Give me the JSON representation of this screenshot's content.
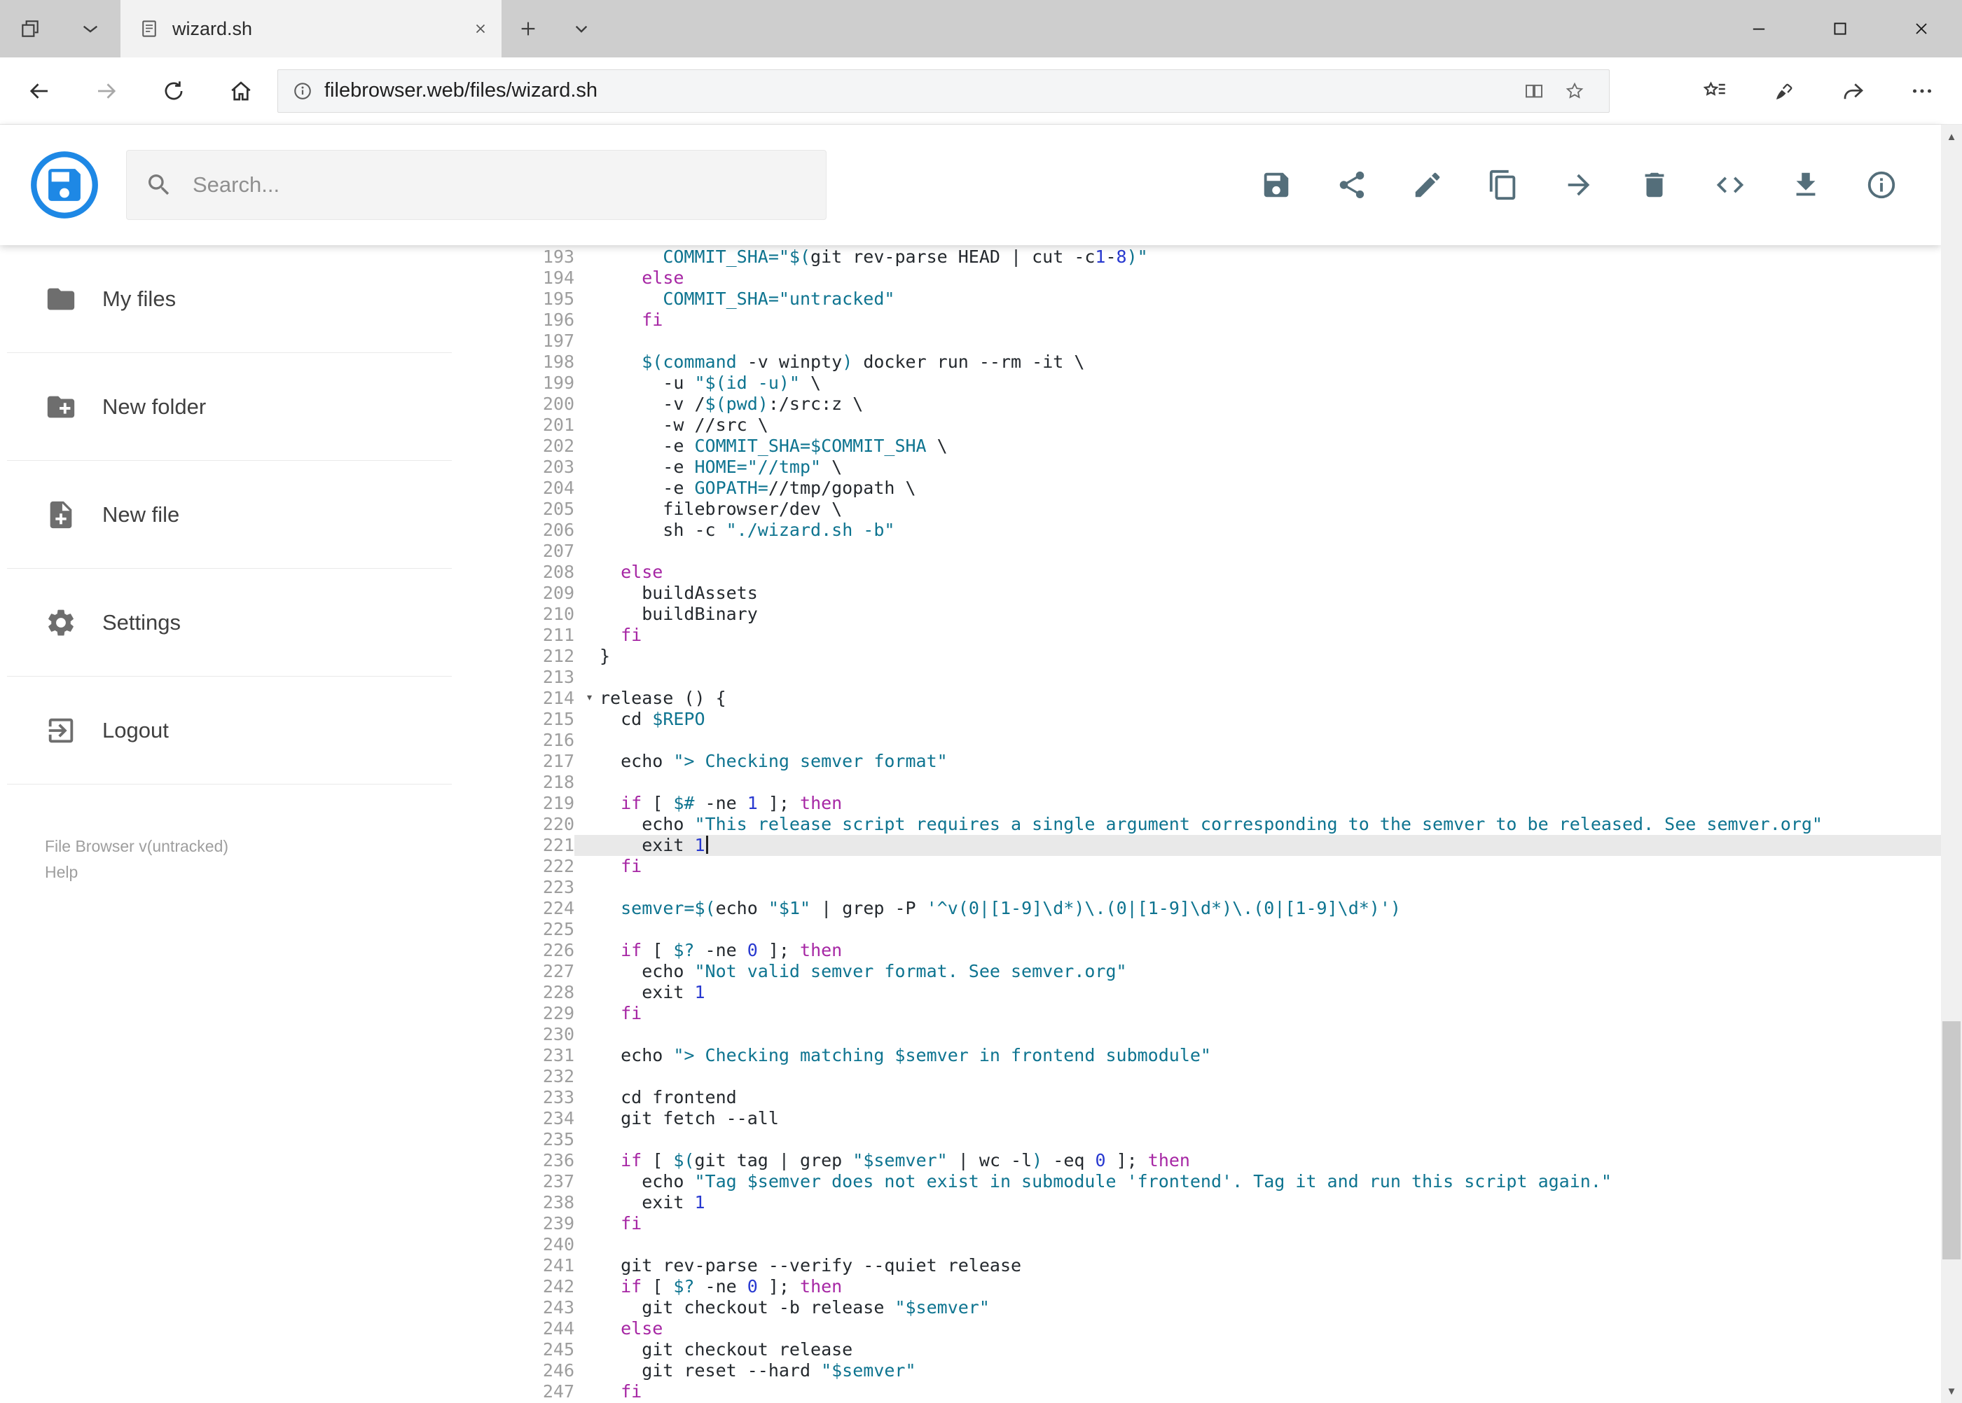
{
  "window": {
    "tab_title": "wizard.sh"
  },
  "browser": {
    "url_domain": "filebrowser.web",
    "url_path": "/files/wizard.sh"
  },
  "app": {
    "search_placeholder": "Search...",
    "actions": [
      {
        "name": "save",
        "icon": "save"
      },
      {
        "name": "share",
        "icon": "share"
      },
      {
        "name": "rename",
        "icon": "pencil"
      },
      {
        "name": "copy",
        "icon": "copy"
      },
      {
        "name": "move",
        "icon": "arrow-forward"
      },
      {
        "name": "delete",
        "icon": "trash"
      },
      {
        "name": "raw",
        "icon": "code"
      },
      {
        "name": "download",
        "icon": "download"
      },
      {
        "name": "info",
        "icon": "info"
      }
    ],
    "sidebar": {
      "items": [
        {
          "label": "My files",
          "icon": "folder"
        },
        {
          "label": "New folder",
          "icon": "folder-plus"
        },
        {
          "label": "New file",
          "icon": "file-plus"
        },
        {
          "label": "Settings",
          "icon": "gear"
        },
        {
          "label": "Logout",
          "icon": "logout"
        }
      ],
      "version": "File Browser v(untracked)",
      "help": "Help"
    }
  },
  "editor": {
    "active_line": 221,
    "lines": [
      {
        "n": 193,
        "segs": [
          [
            "p",
            "      "
          ],
          [
            "s",
            "COMMIT_SHA=\"$("
          ],
          [
            "p",
            "git rev-parse HEAD | cut -c"
          ],
          [
            "n",
            "1"
          ],
          [
            "p",
            "-"
          ],
          [
            "n",
            "8"
          ],
          [
            "s",
            ")\""
          ]
        ]
      },
      {
        "n": 194,
        "segs": [
          [
            "p",
            "    "
          ],
          [
            "k",
            "else"
          ]
        ]
      },
      {
        "n": 195,
        "segs": [
          [
            "p",
            "      "
          ],
          [
            "s",
            "COMMIT_SHA=\"untracked\""
          ]
        ]
      },
      {
        "n": 196,
        "segs": [
          [
            "p",
            "    "
          ],
          [
            "k",
            "fi"
          ]
        ]
      },
      {
        "n": 197,
        "segs": []
      },
      {
        "n": 198,
        "segs": [
          [
            "p",
            "    "
          ],
          [
            "s",
            "$(command"
          ],
          [
            "p",
            " -v winpty"
          ],
          [
            "s",
            ")"
          ],
          [
            "p",
            " docker run --rm -it \\"
          ]
        ]
      },
      {
        "n": 199,
        "segs": [
          [
            "p",
            "      -u "
          ],
          [
            "s",
            "\"$(id -u)\""
          ],
          [
            "p",
            " \\"
          ]
        ]
      },
      {
        "n": 200,
        "segs": [
          [
            "p",
            "      -v /"
          ],
          [
            "s",
            "$(pwd)"
          ],
          [
            "p",
            ":/src:z \\"
          ]
        ]
      },
      {
        "n": 201,
        "segs": [
          [
            "p",
            "      -w //src \\"
          ]
        ]
      },
      {
        "n": 202,
        "segs": [
          [
            "p",
            "      -e "
          ],
          [
            "s",
            "COMMIT_SHA=$COMMIT_SHA"
          ],
          [
            "p",
            " \\"
          ]
        ]
      },
      {
        "n": 203,
        "segs": [
          [
            "p",
            "      -e "
          ],
          [
            "s",
            "HOME=\"//tmp\""
          ],
          [
            "p",
            " \\"
          ]
        ]
      },
      {
        "n": 204,
        "segs": [
          [
            "p",
            "      -e "
          ],
          [
            "s",
            "GOPATH="
          ],
          [
            "p",
            "//tmp/gopath \\"
          ]
        ]
      },
      {
        "n": 205,
        "segs": [
          [
            "p",
            "      filebrowser/dev \\"
          ]
        ]
      },
      {
        "n": 206,
        "segs": [
          [
            "p",
            "      sh -c "
          ],
          [
            "s",
            "\"./wizard.sh -b\""
          ]
        ]
      },
      {
        "n": 207,
        "segs": []
      },
      {
        "n": 208,
        "segs": [
          [
            "p",
            "  "
          ],
          [
            "k",
            "else"
          ]
        ]
      },
      {
        "n": 209,
        "segs": [
          [
            "p",
            "    buildAssets"
          ]
        ]
      },
      {
        "n": 210,
        "segs": [
          [
            "p",
            "    buildBinary"
          ]
        ]
      },
      {
        "n": 211,
        "segs": [
          [
            "p",
            "  "
          ],
          [
            "k",
            "fi"
          ]
        ]
      },
      {
        "n": 212,
        "segs": [
          [
            "p",
            "}"
          ]
        ]
      },
      {
        "n": 213,
        "segs": []
      },
      {
        "n": 214,
        "fold": true,
        "segs": [
          [
            "p",
            "release () {"
          ]
        ]
      },
      {
        "n": 215,
        "segs": [
          [
            "p",
            "  cd "
          ],
          [
            "s",
            "$REPO"
          ]
        ]
      },
      {
        "n": 216,
        "segs": []
      },
      {
        "n": 217,
        "segs": [
          [
            "p",
            "  echo "
          ],
          [
            "s",
            "\"> Checking semver format\""
          ]
        ]
      },
      {
        "n": 218,
        "segs": []
      },
      {
        "n": 219,
        "segs": [
          [
            "p",
            "  "
          ],
          [
            "k",
            "if"
          ],
          [
            "p",
            " [ "
          ],
          [
            "s",
            "$#"
          ],
          [
            "p",
            " -ne "
          ],
          [
            "n",
            "1"
          ],
          [
            "p",
            " ]; "
          ],
          [
            "k",
            "then"
          ]
        ]
      },
      {
        "n": 220,
        "segs": [
          [
            "p",
            "    echo "
          ],
          [
            "s",
            "\"This release script requires a single argument corresponding to the semver to be released. See semver.org\""
          ]
        ]
      },
      {
        "n": 221,
        "cursor": true,
        "segs": [
          [
            "p",
            "    exit "
          ],
          [
            "n",
            "1"
          ]
        ]
      },
      {
        "n": 222,
        "segs": [
          [
            "p",
            "  "
          ],
          [
            "k",
            "fi"
          ]
        ]
      },
      {
        "n": 223,
        "segs": []
      },
      {
        "n": 224,
        "segs": [
          [
            "p",
            "  "
          ],
          [
            "s",
            "semver=$("
          ],
          [
            "p",
            "echo "
          ],
          [
            "s",
            "\"$1\""
          ],
          [
            "p",
            " | grep -P "
          ],
          [
            "s",
            "'^v(0|[1-9]\\d*)\\.(0|[1-9]\\d*)\\.(0|[1-9]\\d*)')"
          ]
        ]
      },
      {
        "n": 225,
        "segs": []
      },
      {
        "n": 226,
        "segs": [
          [
            "p",
            "  "
          ],
          [
            "k",
            "if"
          ],
          [
            "p",
            " [ "
          ],
          [
            "s",
            "$?"
          ],
          [
            "p",
            " -ne "
          ],
          [
            "n",
            "0"
          ],
          [
            "p",
            " ]; "
          ],
          [
            "k",
            "then"
          ]
        ]
      },
      {
        "n": 227,
        "segs": [
          [
            "p",
            "    echo "
          ],
          [
            "s",
            "\"Not valid semver format. See semver.org\""
          ]
        ]
      },
      {
        "n": 228,
        "segs": [
          [
            "p",
            "    exit "
          ],
          [
            "n",
            "1"
          ]
        ]
      },
      {
        "n": 229,
        "segs": [
          [
            "p",
            "  "
          ],
          [
            "k",
            "fi"
          ]
        ]
      },
      {
        "n": 230,
        "segs": []
      },
      {
        "n": 231,
        "segs": [
          [
            "p",
            "  echo "
          ],
          [
            "s",
            "\"> Checking matching $semver in frontend submodule\""
          ]
        ]
      },
      {
        "n": 232,
        "segs": []
      },
      {
        "n": 233,
        "segs": [
          [
            "p",
            "  cd frontend"
          ]
        ]
      },
      {
        "n": 234,
        "segs": [
          [
            "p",
            "  git fetch --all"
          ]
        ]
      },
      {
        "n": 235,
        "segs": []
      },
      {
        "n": 236,
        "segs": [
          [
            "p",
            "  "
          ],
          [
            "k",
            "if"
          ],
          [
            "p",
            " [ "
          ],
          [
            "s",
            "$("
          ],
          [
            "p",
            "git tag | grep "
          ],
          [
            "s",
            "\"$semver\""
          ],
          [
            "p",
            " | wc -l"
          ],
          [
            "s",
            ")"
          ],
          [
            "p",
            " -eq "
          ],
          [
            "n",
            "0"
          ],
          [
            "p",
            " ]; "
          ],
          [
            "k",
            "then"
          ]
        ]
      },
      {
        "n": 237,
        "segs": [
          [
            "p",
            "    echo "
          ],
          [
            "s",
            "\"Tag $semver does not exist in submodule 'frontend'. Tag it and run this script again.\""
          ]
        ]
      },
      {
        "n": 238,
        "segs": [
          [
            "p",
            "    exit "
          ],
          [
            "n",
            "1"
          ]
        ]
      },
      {
        "n": 239,
        "segs": [
          [
            "p",
            "  "
          ],
          [
            "k",
            "fi"
          ]
        ]
      },
      {
        "n": 240,
        "segs": []
      },
      {
        "n": 241,
        "segs": [
          [
            "p",
            "  git rev-parse --verify --quiet release"
          ]
        ]
      },
      {
        "n": 242,
        "segs": [
          [
            "p",
            "  "
          ],
          [
            "k",
            "if"
          ],
          [
            "p",
            " [ "
          ],
          [
            "s",
            "$?"
          ],
          [
            "p",
            " -ne "
          ],
          [
            "n",
            "0"
          ],
          [
            "p",
            " ]; "
          ],
          [
            "k",
            "then"
          ]
        ]
      },
      {
        "n": 243,
        "segs": [
          [
            "p",
            "    git checkout -b release "
          ],
          [
            "s",
            "\"$semver\""
          ]
        ]
      },
      {
        "n": 244,
        "segs": [
          [
            "p",
            "  "
          ],
          [
            "k",
            "else"
          ]
        ]
      },
      {
        "n": 245,
        "segs": [
          [
            "p",
            "    git checkout release"
          ]
        ]
      },
      {
        "n": 246,
        "segs": [
          [
            "p",
            "    git reset --hard "
          ],
          [
            "s",
            "\"$semver\""
          ]
        ]
      },
      {
        "n": 247,
        "segs": [
          [
            "p",
            "  "
          ],
          [
            "k",
            "fi"
          ]
        ]
      }
    ]
  },
  "colors": {
    "accent_blue": "#1e88e5",
    "keyword": "#a626a4",
    "string": "#0e7490",
    "number": "#2839d0",
    "plain": "#24292e",
    "active_line_bg": "#e9e9e9"
  }
}
